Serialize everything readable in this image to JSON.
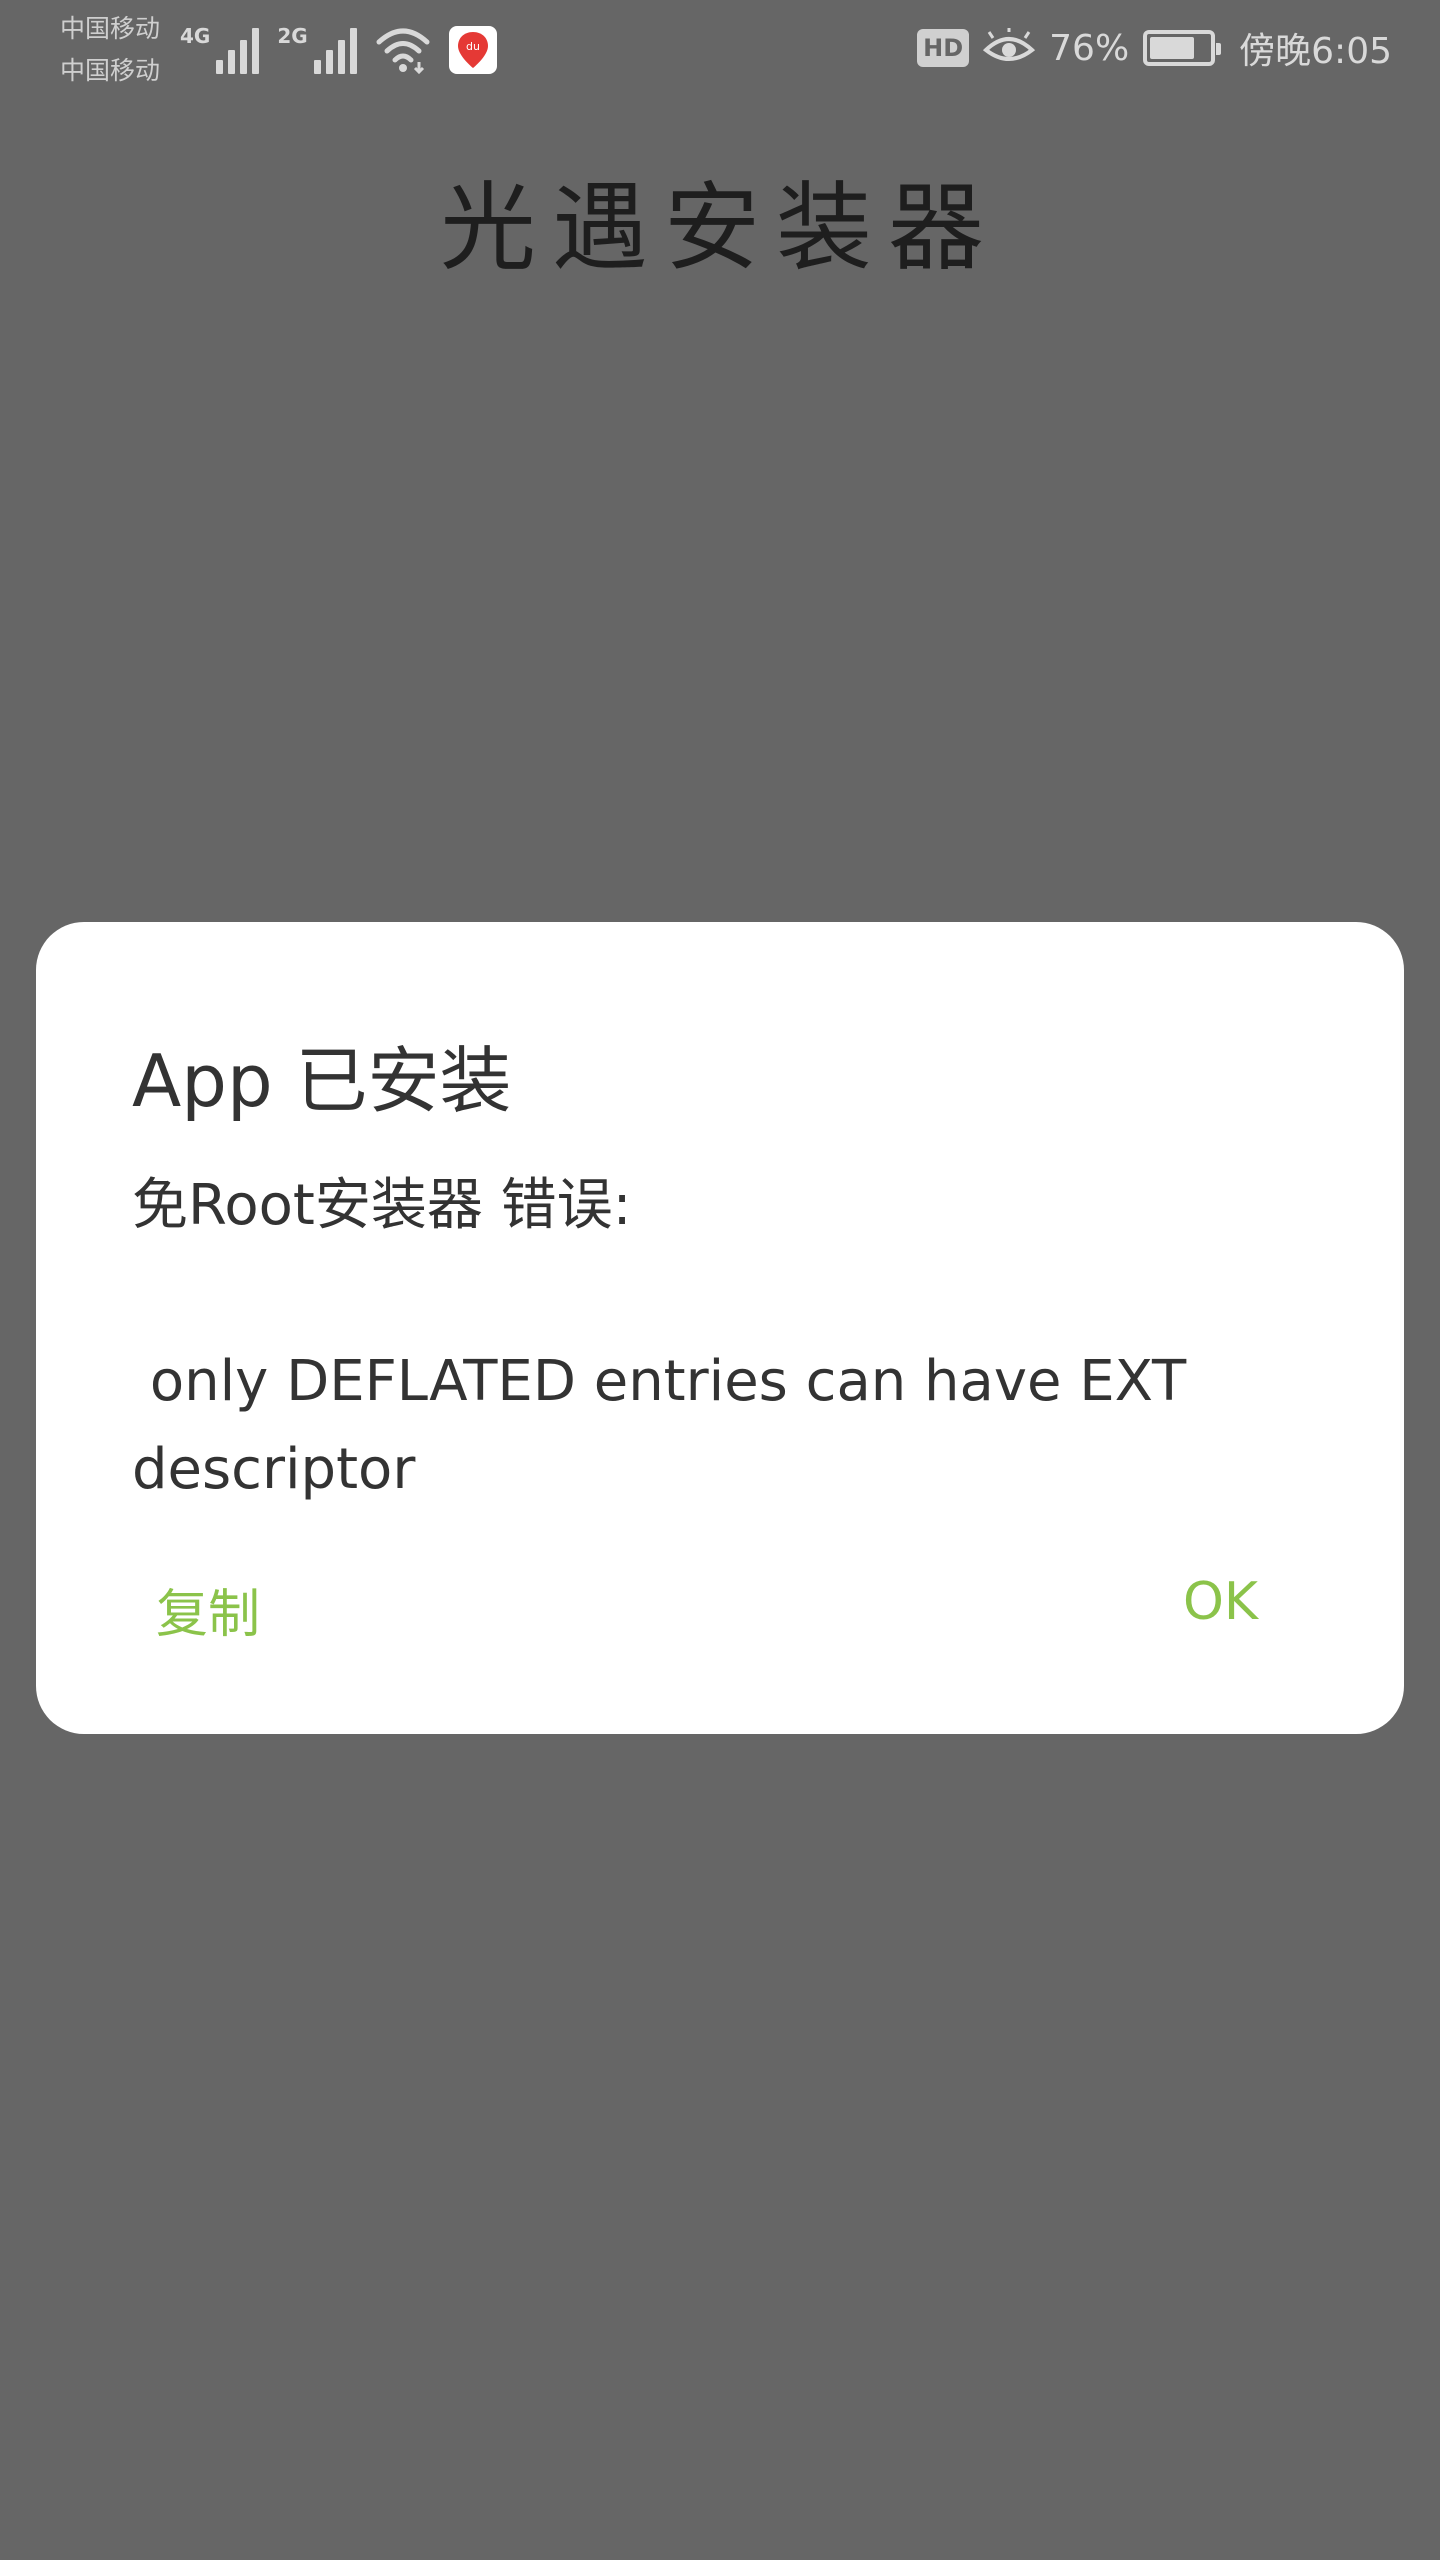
{
  "status_bar": {
    "carrier_1": "中国移动",
    "carrier_2": "中国移动",
    "network_1": "4G",
    "network_2": "2G",
    "hd_badge": "HD",
    "battery_percent": "76%",
    "battery_level": 0.76,
    "time": "傍晚6:05",
    "icons": [
      "signal-icon",
      "wifi-icon",
      "baidu-app-icon",
      "eye-comfort-icon",
      "battery-icon"
    ],
    "baidu_label": "du"
  },
  "app": {
    "title": "光遇安装器"
  },
  "dialog": {
    "title": "App 已安装",
    "message": "免Root安装器 错误:\n\n only DEFLATED entries can have EXT descriptor",
    "copy_label": "复制",
    "ok_label": "OK"
  },
  "colors": {
    "background": "#666666",
    "dialog_bg": "#ffffff",
    "accent": "#8bc34a",
    "title_text": "#1e1e1e",
    "body_text": "#333333"
  }
}
